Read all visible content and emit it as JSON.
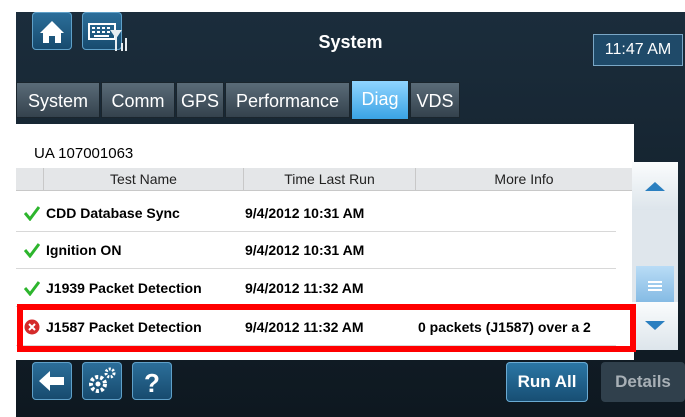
{
  "header": {
    "title": "System",
    "time": "11:47 AM"
  },
  "tabs": [
    {
      "label": "System",
      "active": false
    },
    {
      "label": "Comm",
      "active": false
    },
    {
      "label": "GPS",
      "active": false
    },
    {
      "label": "Performance",
      "active": false
    },
    {
      "label": "Diag",
      "active": true
    },
    {
      "label": "VDS",
      "active": false
    }
  ],
  "unit_label": "UA 107001063",
  "table": {
    "columns": [
      "Test Name",
      "Time Last Run",
      "More Info"
    ],
    "rows": [
      {
        "status": "pass",
        "name": "CDD Database Sync",
        "time": "9/4/2012 10:31 AM",
        "info": ""
      },
      {
        "status": "pass",
        "name": "Ignition ON",
        "time": "9/4/2012 10:31 AM",
        "info": ""
      },
      {
        "status": "pass",
        "name": "J1939 Packet Detection",
        "time": "9/4/2012 11:32 AM",
        "info": ""
      },
      {
        "status": "fail",
        "name": "J1587 Packet Detection",
        "time": "9/4/2012 11:32 AM",
        "info": "0 packets (J1587) over a 2"
      }
    ]
  },
  "footer": {
    "run_all_label": "Run All",
    "details_label": "Details"
  },
  "colors": {
    "highlight": "#ff0000",
    "active_tab": "#3aa3e4",
    "pass": "#2db52d",
    "fail": "#d42a2a"
  },
  "icons": [
    "home-icon",
    "keyboard-icon",
    "signal-icon",
    "back-arrow-icon",
    "settings-icon",
    "help-icon",
    "scroll-up-icon",
    "scroll-down-icon",
    "check-icon",
    "error-icon"
  ]
}
